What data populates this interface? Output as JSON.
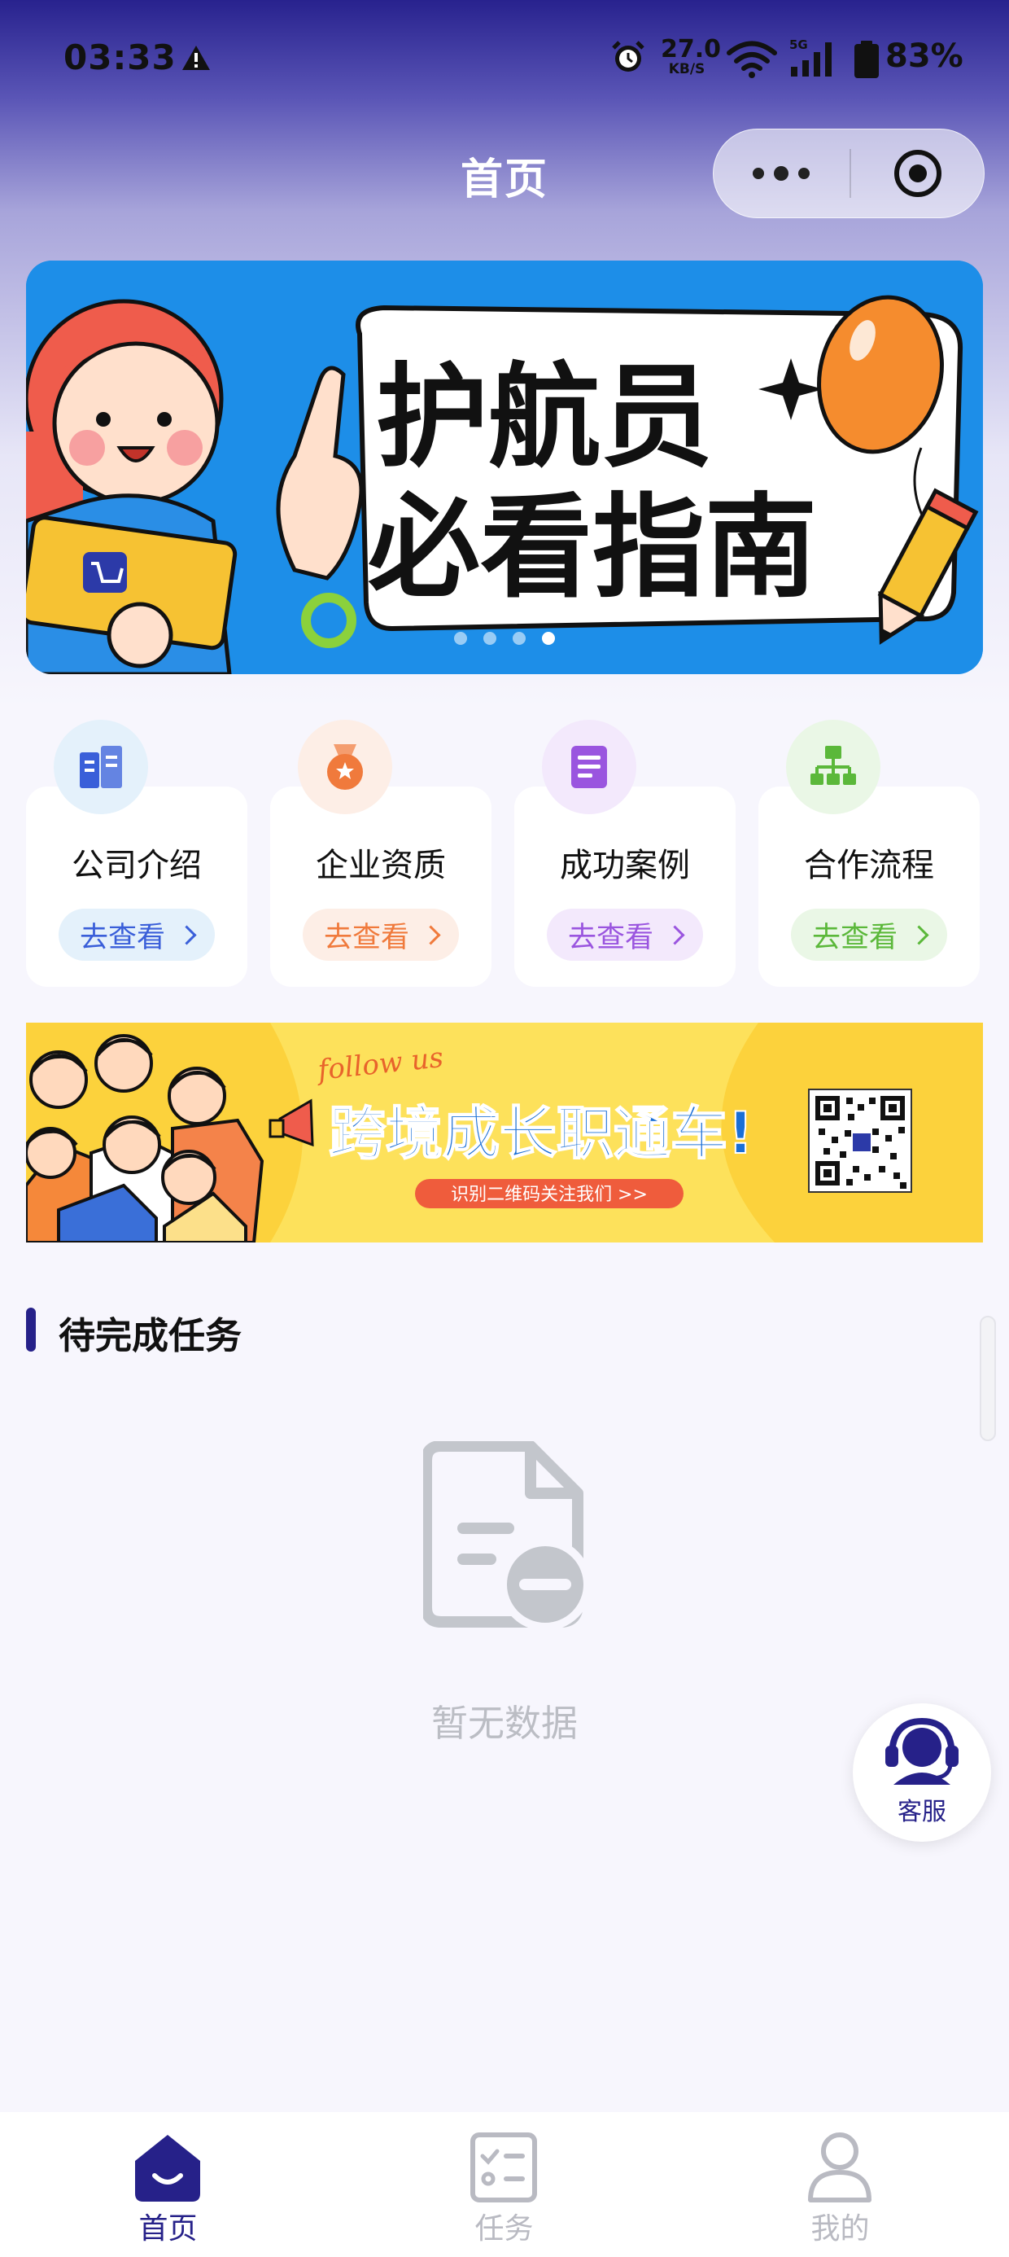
{
  "status_bar": {
    "time": "03:33",
    "net_speed_value": "27.0",
    "net_speed_unit": "KB/S",
    "network_type": "5G",
    "battery": "83%"
  },
  "header": {
    "title": "首页"
  },
  "banner": {
    "line1": "护航员",
    "line2": "必看指南",
    "slide_count": 4,
    "active_slide": 3
  },
  "quick_links": [
    {
      "label": "公司介绍",
      "action": "去查看",
      "color": "#3a5fd9",
      "tint": "#e4f1fb",
      "icon": "building-icon"
    },
    {
      "label": "企业资质",
      "action": "去查看",
      "color": "#f07a3c",
      "tint": "#fdeee6",
      "icon": "medal-icon"
    },
    {
      "label": "成功案例",
      "action": "去查看",
      "color": "#9a55df",
      "tint": "#f3e9fc",
      "icon": "document-icon"
    },
    {
      "label": "合作流程",
      "action": "去查看",
      "color": "#5bb83a",
      "tint": "#eaf7e6",
      "icon": "org-chart-icon"
    }
  ],
  "promo": {
    "script": "follow us",
    "headline": "跨境成长职通车!",
    "cta": "识别二维码关注我们 >>"
  },
  "tasks": {
    "section_title": "待完成任务",
    "empty_text": "暂无数据"
  },
  "service": {
    "label": "客服"
  },
  "tab_bar": {
    "items": [
      {
        "label": "首页",
        "active": true
      },
      {
        "label": "任务",
        "active": false
      },
      {
        "label": "我的",
        "active": false
      }
    ]
  },
  "colors": {
    "brand": "#262189",
    "tab_inactive": "#b9bac2"
  }
}
